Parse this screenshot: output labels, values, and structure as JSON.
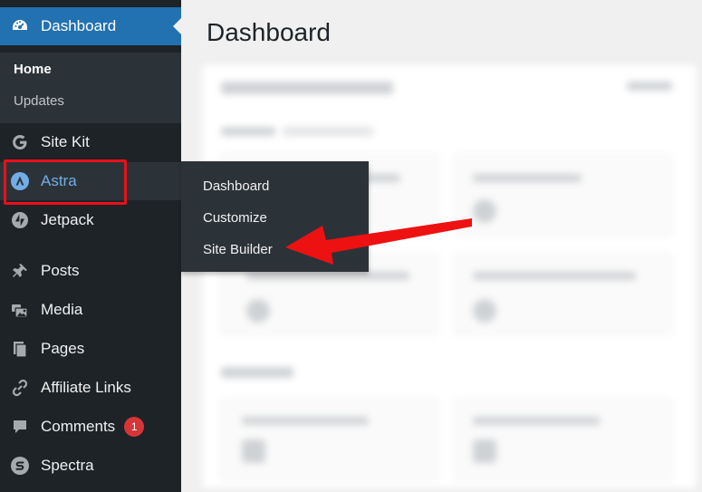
{
  "sidebar": {
    "dashboard_label": "Dashboard",
    "submenu": {
      "home": "Home",
      "updates": "Updates"
    },
    "items": [
      {
        "label": "Site Kit",
        "icon": "google-g-icon"
      },
      {
        "label": "Astra",
        "icon": "astra-logo-icon"
      },
      {
        "label": "Jetpack",
        "icon": "jetpack-bolt-icon"
      },
      {
        "label": "Posts",
        "icon": "pushpin-icon"
      },
      {
        "label": "Media",
        "icon": "media-icon"
      },
      {
        "label": "Pages",
        "icon": "pages-icon"
      },
      {
        "label": "Affiliate Links",
        "icon": "link-icon"
      },
      {
        "label": "Comments",
        "icon": "comment-icon",
        "badge": "1"
      },
      {
        "label": "Spectra",
        "icon": "spectra-icon"
      }
    ]
  },
  "flyout": {
    "items": [
      "Dashboard",
      "Customize",
      "Site Builder"
    ]
  },
  "main": {
    "title": "Dashboard"
  },
  "colors": {
    "sidebar": "#1d2327",
    "active": "#2271b1",
    "hover_text": "#72aee6",
    "highlight": "#e8101a",
    "badge": "#d63638"
  }
}
